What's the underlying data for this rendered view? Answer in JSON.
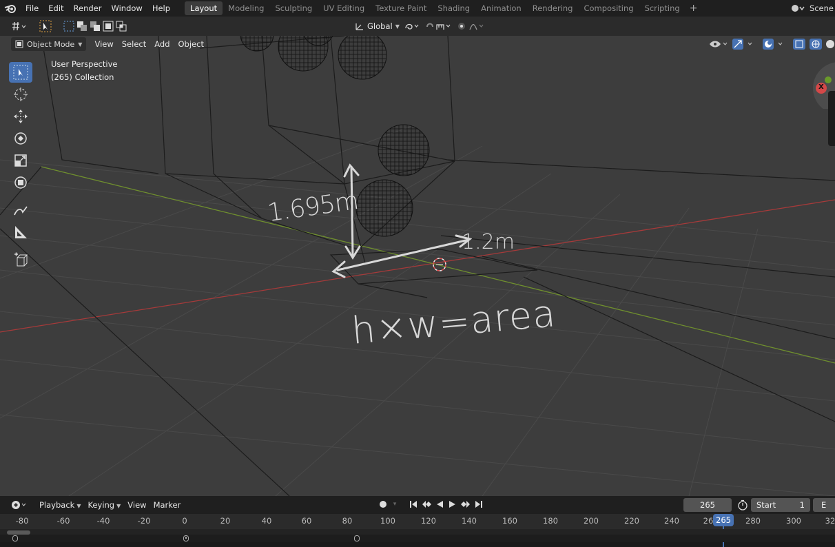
{
  "menubar": {
    "items": [
      "File",
      "Edit",
      "Render",
      "Window",
      "Help"
    ],
    "workspaces": [
      "Layout",
      "Modeling",
      "Sculpting",
      "UV Editing",
      "Texture Paint",
      "Shading",
      "Animation",
      "Rendering",
      "Compositing",
      "Scripting"
    ],
    "active_workspace": "Layout",
    "add_tab": "+",
    "scene_label": "Scene"
  },
  "tool_header": {
    "orientation": "Global"
  },
  "viewport": {
    "mode": "Object Mode",
    "menu": [
      "View",
      "Select",
      "Add",
      "Object"
    ],
    "view_name": "User Perspective",
    "collection": "(265) Collection",
    "gizmo_axis": "X",
    "annotations": {
      "height": "1.695m",
      "width": "1.2m",
      "formula": "h×w=area"
    }
  },
  "timeline": {
    "menu": [
      "Playback",
      "Keying",
      "View",
      "Marker"
    ],
    "current_frame": "265",
    "start_label": "Start",
    "start_value": "1",
    "end_label": "E",
    "ruler_labels": [
      "-80",
      "-60",
      "-40",
      "-20",
      "0",
      "20",
      "40",
      "60",
      "80",
      "100",
      "120",
      "140",
      "160",
      "180",
      "200",
      "220",
      "240",
      "26",
      "280",
      "300",
      "32"
    ],
    "playhead_label": "265"
  },
  "colors": {
    "accent": "#4772b3",
    "x_axis": "#c24b4b",
    "y_axis": "#7aa33a",
    "viewport_bg": "#3d3d3d"
  }
}
